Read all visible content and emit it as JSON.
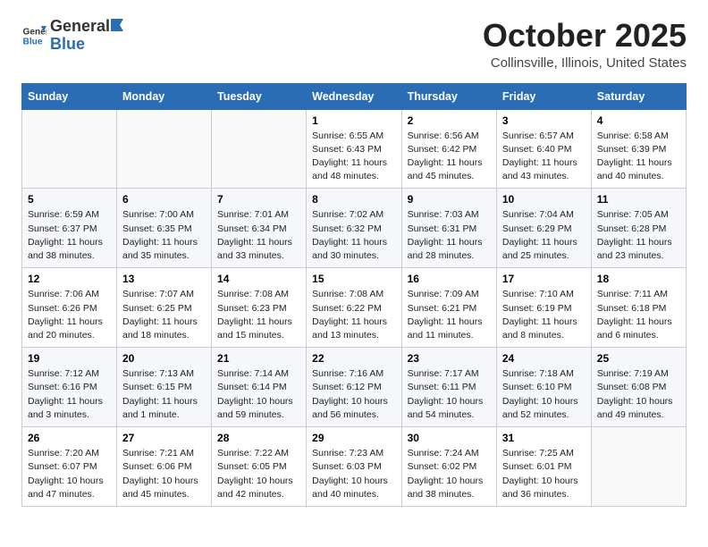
{
  "logo": {
    "general": "General",
    "blue": "Blue"
  },
  "title": "October 2025",
  "location": "Collinsville, Illinois, United States",
  "days_of_week": [
    "Sunday",
    "Monday",
    "Tuesday",
    "Wednesday",
    "Thursday",
    "Friday",
    "Saturday"
  ],
  "weeks": [
    [
      {
        "num": "",
        "info": ""
      },
      {
        "num": "",
        "info": ""
      },
      {
        "num": "",
        "info": ""
      },
      {
        "num": "1",
        "info": "Sunrise: 6:55 AM\nSunset: 6:43 PM\nDaylight: 11 hours and 48 minutes."
      },
      {
        "num": "2",
        "info": "Sunrise: 6:56 AM\nSunset: 6:42 PM\nDaylight: 11 hours and 45 minutes."
      },
      {
        "num": "3",
        "info": "Sunrise: 6:57 AM\nSunset: 6:40 PM\nDaylight: 11 hours and 43 minutes."
      },
      {
        "num": "4",
        "info": "Sunrise: 6:58 AM\nSunset: 6:39 PM\nDaylight: 11 hours and 40 minutes."
      }
    ],
    [
      {
        "num": "5",
        "info": "Sunrise: 6:59 AM\nSunset: 6:37 PM\nDaylight: 11 hours and 38 minutes."
      },
      {
        "num": "6",
        "info": "Sunrise: 7:00 AM\nSunset: 6:35 PM\nDaylight: 11 hours and 35 minutes."
      },
      {
        "num": "7",
        "info": "Sunrise: 7:01 AM\nSunset: 6:34 PM\nDaylight: 11 hours and 33 minutes."
      },
      {
        "num": "8",
        "info": "Sunrise: 7:02 AM\nSunset: 6:32 PM\nDaylight: 11 hours and 30 minutes."
      },
      {
        "num": "9",
        "info": "Sunrise: 7:03 AM\nSunset: 6:31 PM\nDaylight: 11 hours and 28 minutes."
      },
      {
        "num": "10",
        "info": "Sunrise: 7:04 AM\nSunset: 6:29 PM\nDaylight: 11 hours and 25 minutes."
      },
      {
        "num": "11",
        "info": "Sunrise: 7:05 AM\nSunset: 6:28 PM\nDaylight: 11 hours and 23 minutes."
      }
    ],
    [
      {
        "num": "12",
        "info": "Sunrise: 7:06 AM\nSunset: 6:26 PM\nDaylight: 11 hours and 20 minutes."
      },
      {
        "num": "13",
        "info": "Sunrise: 7:07 AM\nSunset: 6:25 PM\nDaylight: 11 hours and 18 minutes."
      },
      {
        "num": "14",
        "info": "Sunrise: 7:08 AM\nSunset: 6:23 PM\nDaylight: 11 hours and 15 minutes."
      },
      {
        "num": "15",
        "info": "Sunrise: 7:08 AM\nSunset: 6:22 PM\nDaylight: 11 hours and 13 minutes."
      },
      {
        "num": "16",
        "info": "Sunrise: 7:09 AM\nSunset: 6:21 PM\nDaylight: 11 hours and 11 minutes."
      },
      {
        "num": "17",
        "info": "Sunrise: 7:10 AM\nSunset: 6:19 PM\nDaylight: 11 hours and 8 minutes."
      },
      {
        "num": "18",
        "info": "Sunrise: 7:11 AM\nSunset: 6:18 PM\nDaylight: 11 hours and 6 minutes."
      }
    ],
    [
      {
        "num": "19",
        "info": "Sunrise: 7:12 AM\nSunset: 6:16 PM\nDaylight: 11 hours and 3 minutes."
      },
      {
        "num": "20",
        "info": "Sunrise: 7:13 AM\nSunset: 6:15 PM\nDaylight: 11 hours and 1 minute."
      },
      {
        "num": "21",
        "info": "Sunrise: 7:14 AM\nSunset: 6:14 PM\nDaylight: 10 hours and 59 minutes."
      },
      {
        "num": "22",
        "info": "Sunrise: 7:16 AM\nSunset: 6:12 PM\nDaylight: 10 hours and 56 minutes."
      },
      {
        "num": "23",
        "info": "Sunrise: 7:17 AM\nSunset: 6:11 PM\nDaylight: 10 hours and 54 minutes."
      },
      {
        "num": "24",
        "info": "Sunrise: 7:18 AM\nSunset: 6:10 PM\nDaylight: 10 hours and 52 minutes."
      },
      {
        "num": "25",
        "info": "Sunrise: 7:19 AM\nSunset: 6:08 PM\nDaylight: 10 hours and 49 minutes."
      }
    ],
    [
      {
        "num": "26",
        "info": "Sunrise: 7:20 AM\nSunset: 6:07 PM\nDaylight: 10 hours and 47 minutes."
      },
      {
        "num": "27",
        "info": "Sunrise: 7:21 AM\nSunset: 6:06 PM\nDaylight: 10 hours and 45 minutes."
      },
      {
        "num": "28",
        "info": "Sunrise: 7:22 AM\nSunset: 6:05 PM\nDaylight: 10 hours and 42 minutes."
      },
      {
        "num": "29",
        "info": "Sunrise: 7:23 AM\nSunset: 6:03 PM\nDaylight: 10 hours and 40 minutes."
      },
      {
        "num": "30",
        "info": "Sunrise: 7:24 AM\nSunset: 6:02 PM\nDaylight: 10 hours and 38 minutes."
      },
      {
        "num": "31",
        "info": "Sunrise: 7:25 AM\nSunset: 6:01 PM\nDaylight: 10 hours and 36 minutes."
      },
      {
        "num": "",
        "info": ""
      }
    ]
  ]
}
